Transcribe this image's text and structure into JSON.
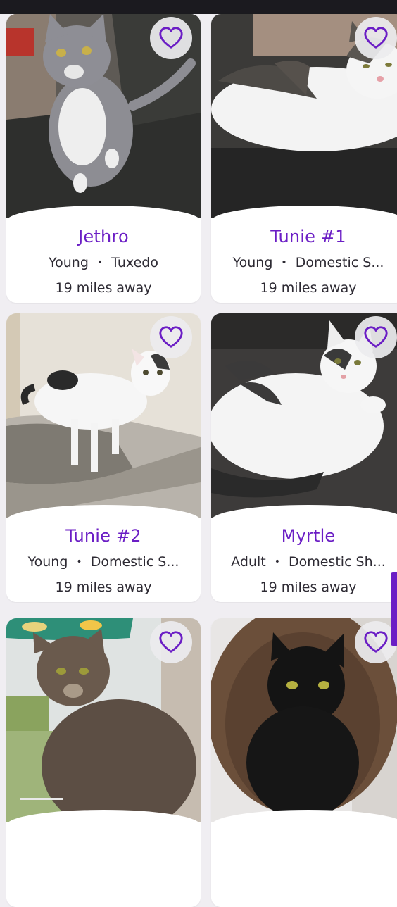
{
  "pets": [
    {
      "name": "Jethro",
      "age": "Young",
      "breed": "Tuxedo",
      "distance": "19 miles away"
    },
    {
      "name": "Tunie #1",
      "age": "Young",
      "breed": "Domestic S...",
      "distance": "19 miles away"
    },
    {
      "name": "Tunie #2",
      "age": "Young",
      "breed": "Domestic S...",
      "distance": "19 miles away"
    },
    {
      "name": "Myrtle",
      "age": "Adult",
      "breed": "Domestic Sh...",
      "distance": "19 miles away"
    },
    {
      "name": "",
      "age": "",
      "breed": "",
      "distance": ""
    },
    {
      "name": "",
      "age": "",
      "breed": "",
      "distance": ""
    }
  ],
  "separator": "•",
  "icons": {
    "favorite": "heart-outline-icon"
  },
  "colors": {
    "accent": "#6b1ec5",
    "text": "#2d2a33",
    "background": "#f0eef2",
    "status_bar": "#1b1a1f",
    "favorite_button_bg": "#ececee"
  }
}
